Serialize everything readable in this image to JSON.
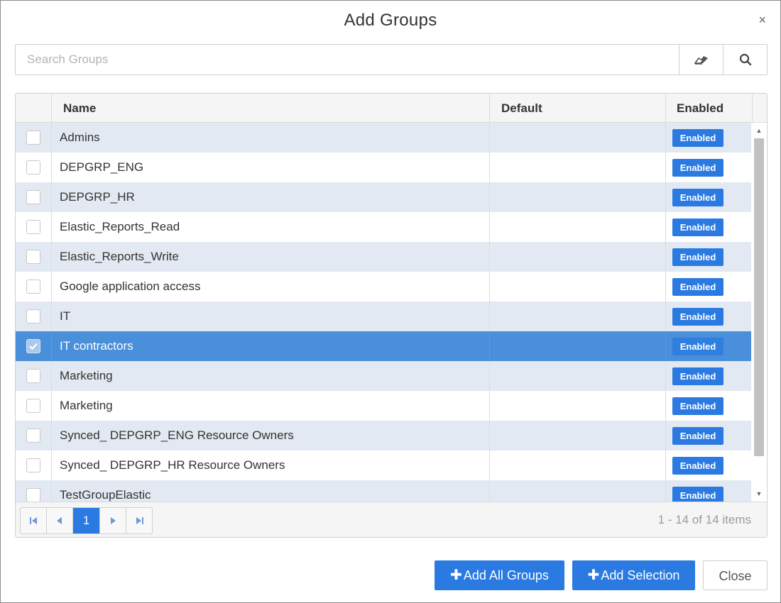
{
  "dialog": {
    "title": "Add Groups",
    "close_glyph": "×"
  },
  "search": {
    "placeholder": "Search Groups",
    "value": "",
    "clear_icon": "eraser-icon",
    "search_icon": "magnifier-icon"
  },
  "table": {
    "columns": {
      "name": "Name",
      "default": "Default",
      "enabled": "Enabled"
    },
    "rows": [
      {
        "name": "Admins",
        "default": "",
        "status": "Enabled",
        "checked": false
      },
      {
        "name": "DEPGRP_ENG",
        "default": "",
        "status": "Enabled",
        "checked": false
      },
      {
        "name": "DEPGRP_HR",
        "default": "",
        "status": "Enabled",
        "checked": false
      },
      {
        "name": "Elastic_Reports_Read",
        "default": "",
        "status": "Enabled",
        "checked": false
      },
      {
        "name": "Elastic_Reports_Write",
        "default": "",
        "status": "Enabled",
        "checked": false
      },
      {
        "name": "Google application access",
        "default": "",
        "status": "Enabled",
        "checked": false
      },
      {
        "name": "IT",
        "default": "",
        "status": "Enabled",
        "checked": false
      },
      {
        "name": "IT contractors",
        "default": "",
        "status": "Enabled",
        "checked": true
      },
      {
        "name": "Marketing",
        "default": "",
        "status": "Enabled",
        "checked": false
      },
      {
        "name": "Marketing",
        "default": "",
        "status": "Enabled",
        "checked": false
      },
      {
        "name": "Synced_ DEPGRP_ENG Resource Owners",
        "default": "",
        "status": "Enabled",
        "checked": false
      },
      {
        "name": "Synced_ DEPGRP_HR Resource Owners",
        "default": "",
        "status": "Enabled",
        "checked": false
      },
      {
        "name": "TestGroupElastic",
        "default": "",
        "status": "Enabled",
        "checked": false
      }
    ]
  },
  "pager": {
    "current_page": "1",
    "info": "1 - 14 of 14 items"
  },
  "footer": {
    "add_all_label": "Add All Groups",
    "add_selection_label": "Add Selection",
    "close_label": "Close"
  },
  "colors": {
    "accent": "#2a7ae2",
    "selected_row": "#4a8fd9",
    "alt_row": "#e3e9f2"
  }
}
